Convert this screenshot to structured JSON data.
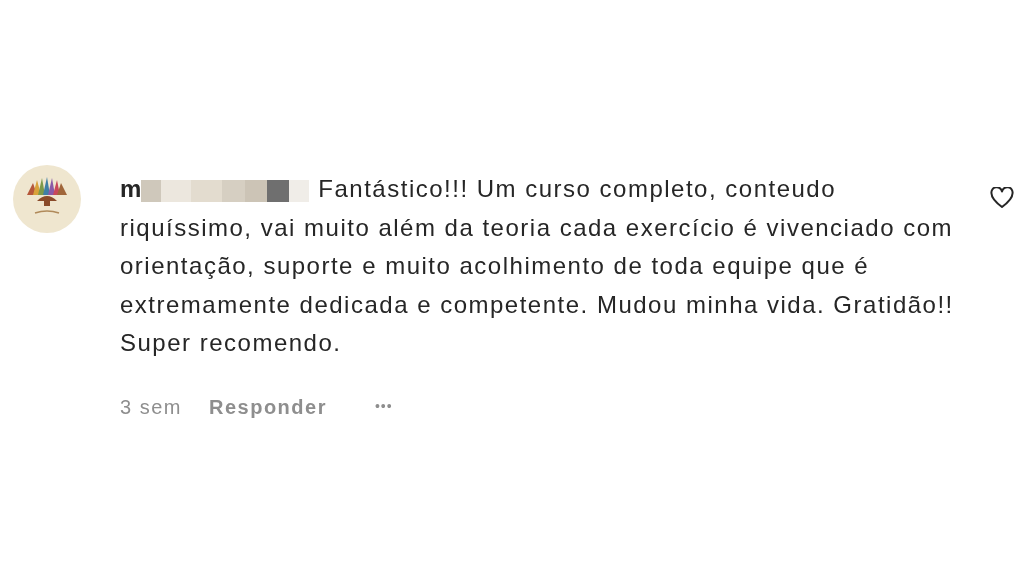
{
  "comment": {
    "username": "m",
    "text": "Fantástico!!! Um curso completo, conteudo riquíssimo, vai muito além da teoria cada exercício é vivenciado com orientação, suporte e muito acolhimento de toda equipe que é extremamente dedicada e competente. Mudou minha vida. Gratidão!! Super recomendo.",
    "liked": false,
    "time": "3 sem",
    "reply": "Responder",
    "more": "•••"
  }
}
